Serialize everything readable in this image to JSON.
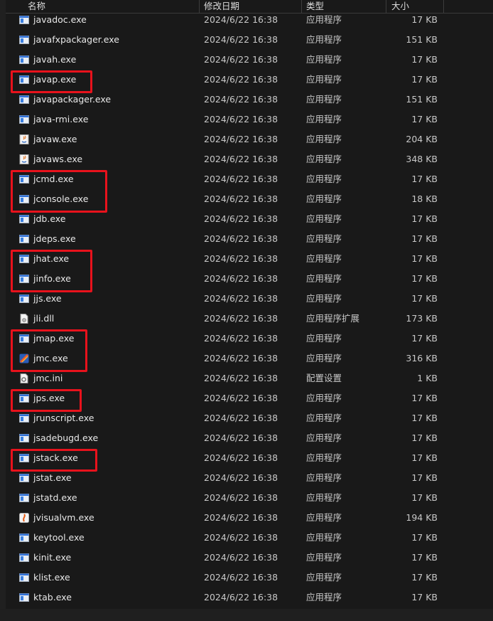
{
  "columns": {
    "name": "名称",
    "date": "修改日期",
    "type": "类型",
    "size": "大小"
  },
  "files": [
    {
      "name": "javadoc.exe",
      "date": "2024/6/22 16:38",
      "type": "应用程序",
      "size": "17 KB",
      "icon": "exe"
    },
    {
      "name": "javafxpackager.exe",
      "date": "2024/6/22 16:38",
      "type": "应用程序",
      "size": "151 KB",
      "icon": "exe"
    },
    {
      "name": "javah.exe",
      "date": "2024/6/22 16:38",
      "type": "应用程序",
      "size": "17 KB",
      "icon": "exe"
    },
    {
      "name": "javap.exe",
      "date": "2024/6/22 16:38",
      "type": "应用程序",
      "size": "17 KB",
      "icon": "exe",
      "highlight": true
    },
    {
      "name": "javapackager.exe",
      "date": "2024/6/22 16:38",
      "type": "应用程序",
      "size": "151 KB",
      "icon": "exe"
    },
    {
      "name": "java-rmi.exe",
      "date": "2024/6/22 16:38",
      "type": "应用程序",
      "size": "17 KB",
      "icon": "exe"
    },
    {
      "name": "javaw.exe",
      "date": "2024/6/22 16:38",
      "type": "应用程序",
      "size": "204 KB",
      "icon": "java"
    },
    {
      "name": "javaws.exe",
      "date": "2024/6/22 16:38",
      "type": "应用程序",
      "size": "348 KB",
      "icon": "java"
    },
    {
      "name": "jcmd.exe",
      "date": "2024/6/22 16:38",
      "type": "应用程序",
      "size": "17 KB",
      "icon": "exe",
      "highlight": true
    },
    {
      "name": "jconsole.exe",
      "date": "2024/6/22 16:38",
      "type": "应用程序",
      "size": "18 KB",
      "icon": "exe",
      "highlight": true
    },
    {
      "name": "jdb.exe",
      "date": "2024/6/22 16:38",
      "type": "应用程序",
      "size": "17 KB",
      "icon": "exe"
    },
    {
      "name": "jdeps.exe",
      "date": "2024/6/22 16:38",
      "type": "应用程序",
      "size": "17 KB",
      "icon": "exe"
    },
    {
      "name": "jhat.exe",
      "date": "2024/6/22 16:38",
      "type": "应用程序",
      "size": "17 KB",
      "icon": "exe",
      "highlight": true
    },
    {
      "name": "jinfo.exe",
      "date": "2024/6/22 16:38",
      "type": "应用程序",
      "size": "17 KB",
      "icon": "exe",
      "highlight": true
    },
    {
      "name": "jjs.exe",
      "date": "2024/6/22 16:38",
      "type": "应用程序",
      "size": "17 KB",
      "icon": "exe"
    },
    {
      "name": "jli.dll",
      "date": "2024/6/22 16:38",
      "type": "应用程序扩展",
      "size": "173 KB",
      "icon": "dll"
    },
    {
      "name": "jmap.exe",
      "date": "2024/6/22 16:38",
      "type": "应用程序",
      "size": "17 KB",
      "icon": "exe",
      "highlight": true
    },
    {
      "name": "jmc.exe",
      "date": "2024/6/22 16:38",
      "type": "应用程序",
      "size": "316 KB",
      "icon": "jmc",
      "highlight": true
    },
    {
      "name": "jmc.ini",
      "date": "2024/6/22 16:38",
      "type": "配置设置",
      "size": "1 KB",
      "icon": "ini"
    },
    {
      "name": "jps.exe",
      "date": "2024/6/22 16:38",
      "type": "应用程序",
      "size": "17 KB",
      "icon": "exe",
      "highlight": true
    },
    {
      "name": "jrunscript.exe",
      "date": "2024/6/22 16:38",
      "type": "应用程序",
      "size": "17 KB",
      "icon": "exe"
    },
    {
      "name": "jsadebugd.exe",
      "date": "2024/6/22 16:38",
      "type": "应用程序",
      "size": "17 KB",
      "icon": "exe"
    },
    {
      "name": "jstack.exe",
      "date": "2024/6/22 16:38",
      "type": "应用程序",
      "size": "17 KB",
      "icon": "exe",
      "highlight": true
    },
    {
      "name": "jstat.exe",
      "date": "2024/6/22 16:38",
      "type": "应用程序",
      "size": "17 KB",
      "icon": "exe"
    },
    {
      "name": "jstatd.exe",
      "date": "2024/6/22 16:38",
      "type": "应用程序",
      "size": "17 KB",
      "icon": "exe"
    },
    {
      "name": "jvisualvm.exe",
      "date": "2024/6/22 16:38",
      "type": "应用程序",
      "size": "194 KB",
      "icon": "jvisualvm"
    },
    {
      "name": "keytool.exe",
      "date": "2024/6/22 16:38",
      "type": "应用程序",
      "size": "17 KB",
      "icon": "exe"
    },
    {
      "name": "kinit.exe",
      "date": "2024/6/22 16:38",
      "type": "应用程序",
      "size": "17 KB",
      "icon": "exe"
    },
    {
      "name": "klist.exe",
      "date": "2024/6/22 16:38",
      "type": "应用程序",
      "size": "17 KB",
      "icon": "exe"
    },
    {
      "name": "ktab.exe",
      "date": "2024/6/22 16:38",
      "type": "应用程序",
      "size": "17 KB",
      "icon": "exe"
    }
  ],
  "highlight_groups": [
    [
      3
    ],
    [
      8,
      9
    ],
    [
      12,
      13
    ],
    [
      16,
      17
    ],
    [
      19
    ],
    [
      22
    ]
  ],
  "colors": {
    "background": "#191919",
    "text": "#e8e8e8",
    "highlight": "#e8121c"
  }
}
